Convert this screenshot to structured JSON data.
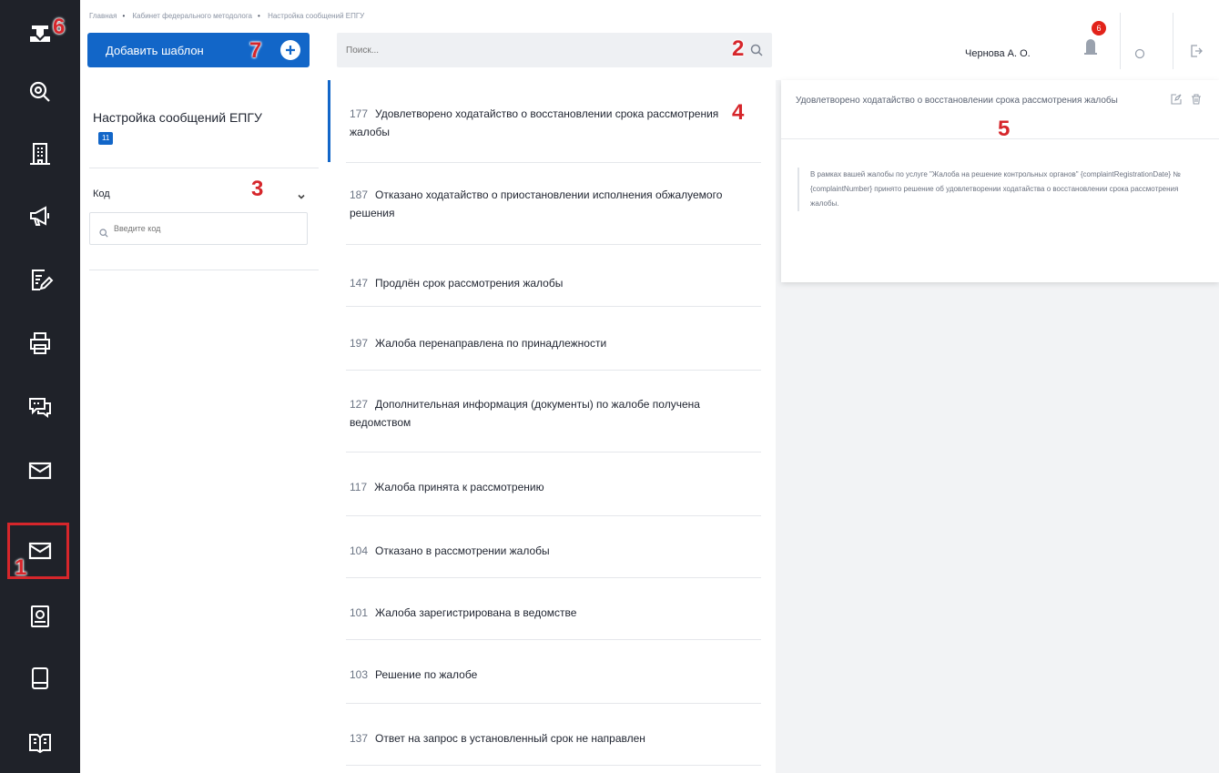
{
  "breadcrumb": [
    "Главная",
    "Кабинет федерального методолога",
    "Настройка сообщений ЕПГУ"
  ],
  "toolbar": {
    "add_template_label": "Добавить шаблон",
    "search_placeholder": "Поиск..."
  },
  "header": {
    "user_name": "Чернова А. О.",
    "notification_count": "6"
  },
  "filter": {
    "title": "Настройка сообщений ЕПГУ",
    "count_badge": "11",
    "code_label": "Код",
    "code_placeholder": "Введите код"
  },
  "messages": [
    {
      "code": "177",
      "text": "Удовлетворено ходатайство о восстановлении срока рассмотрения жалобы"
    },
    {
      "code": "187",
      "text": "Отказано ходатайство о приостановлении исполнения обжалуемого решения"
    },
    {
      "code": "147",
      "text": "Продлён срок рассмотрения жалобы"
    },
    {
      "code": "197",
      "text": "Жалоба перенаправлена по принадлежности"
    },
    {
      "code": "127",
      "text": "Дополнительная информация (документы) по жалобе получена ведомством"
    },
    {
      "code": "117",
      "text": "Жалоба принята к рассмотрению"
    },
    {
      "code": "104",
      "text": "Отказано в рассмотрении жалобы"
    },
    {
      "code": "101",
      "text": "Жалоба зарегистрирована в ведомстве"
    },
    {
      "code": "103",
      "text": "Решение по жалобе"
    },
    {
      "code": "137",
      "text": "Ответ на запрос в установленный срок не направлен"
    }
  ],
  "detail": {
    "title": "Удовлетворено ходатайство о восстановлении срока рассмотрения жалобы",
    "body": "В рамках вашей жалобы по услуге \"Жалоба на решение контрольных органов\" {complaintRegistrationDate} № {complaintNumber} принято решение об удовлетворении ходатайства о восстановлении срока рассмотрения жалобы."
  },
  "markers": [
    "1",
    "2",
    "3",
    "4",
    "5",
    "6",
    "7"
  ],
  "sidebar_icons": [
    "logo-icon",
    "search-icon",
    "building-icon",
    "megaphone-icon",
    "document-edit-icon",
    "printer-icon",
    "chat-icon",
    "mail-icon",
    "mail-icon",
    "certificate-icon",
    "book-icon",
    "open-book-icon"
  ],
  "colors": {
    "accent": "#1266c8",
    "rail": "#1f2229",
    "marker": "#d6262b",
    "badge": "#e2231a"
  }
}
